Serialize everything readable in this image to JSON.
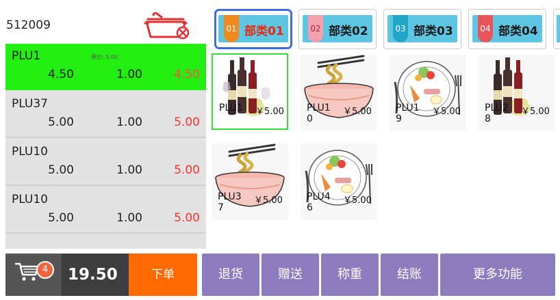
{
  "order": {
    "number": "512009",
    "items": [
      {
        "name": "PLU1",
        "orig_price": "原价: 5.00",
        "price": "4.50",
        "qty": "1.00",
        "amount": "4.50",
        "selected": true
      },
      {
        "name": "PLU37",
        "orig_price": "",
        "price": "5.00",
        "qty": "1.00",
        "amount": "5.00",
        "selected": false
      },
      {
        "name": "PLU10",
        "orig_price": "",
        "price": "5.00",
        "qty": "1.00",
        "amount": "5.00",
        "selected": false
      },
      {
        "name": "PLU10",
        "orig_price": "",
        "price": "5.00",
        "qty": "1.00",
        "amount": "5.00",
        "selected": false
      }
    ]
  },
  "cart": {
    "count": "4",
    "total": "19.50",
    "submit_label": "下单"
  },
  "categories": [
    {
      "code": "01",
      "label": "部类01",
      "active": true,
      "flag_color": "#f08a1c"
    },
    {
      "code": "02",
      "label": "部类02",
      "active": false,
      "flag_color": "#f3a3b0"
    },
    {
      "code": "03",
      "label": "部类03",
      "active": false,
      "flag_color": "#1fa6c9"
    },
    {
      "code": "04",
      "label": "部类04",
      "active": false,
      "flag_color": "#e8545a"
    }
  ],
  "products": [
    {
      "name": "PLU1",
      "price": "￥5.00",
      "image": "wine-icon",
      "selected": true
    },
    {
      "name": "PLU10",
      "price": "￥5.00",
      "image": "noodle-bowl-icon",
      "selected": false
    },
    {
      "name": "PLU19",
      "price": "￥5.00",
      "image": "food-plate-icon",
      "selected": false
    },
    {
      "name": "PLU28",
      "price": "￥5.00",
      "image": "wine-icon",
      "selected": false
    },
    {
      "name": "PLU37",
      "price": "￥5.00",
      "image": "noodle-bowl-icon",
      "selected": false
    },
    {
      "name": "PLU46",
      "price": "￥5.00",
      "image": "food-plate-icon",
      "selected": false
    }
  ],
  "actions": {
    "return_label": "退货",
    "gift_label": "赠送",
    "weigh_label": "称重",
    "checkout_label": "结账",
    "more_label": "更多功能"
  },
  "colors": {
    "selected_row": "#22ee11",
    "submit": "#ff6a00",
    "action_button": "#8c7bbd",
    "tab_fill": "#5ec6e2",
    "active_tab_border": "#3f6be0",
    "amount_text": "#ff3030"
  }
}
